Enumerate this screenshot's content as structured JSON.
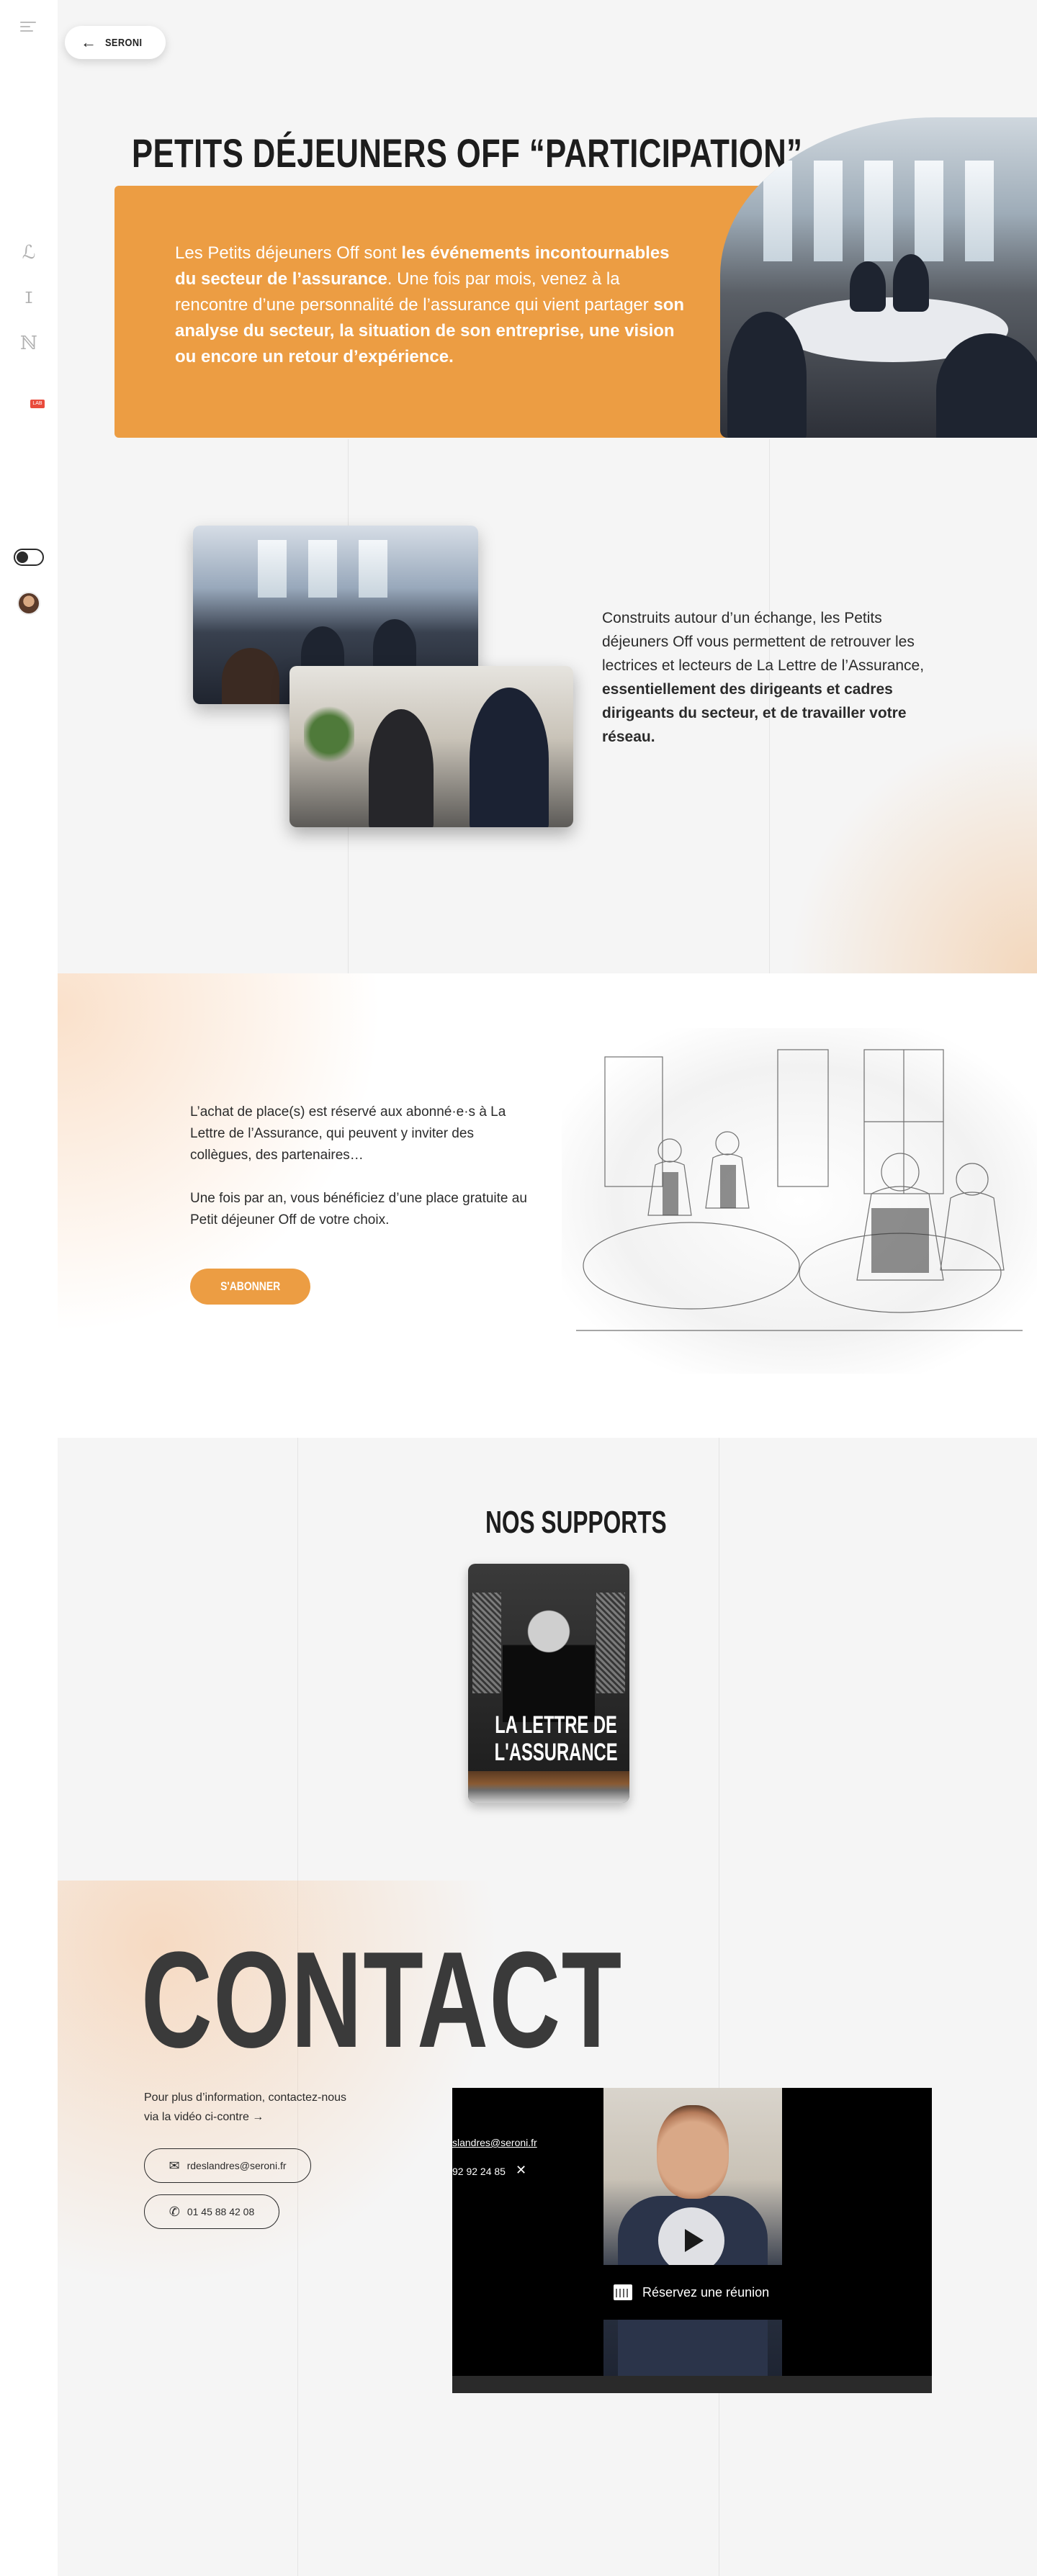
{
  "nav": {
    "back_label": "SERONI",
    "rail_lab_badge": "LAB"
  },
  "hero": {
    "title": "PETITS DÉJEUNERS OFF “PARTICIPATION”",
    "text_parts": [
      "Les Petits déjeuners Off sont ",
      "les événements incontournables du secteur de l’assurance",
      ". Une fois par mois, venez à la rencontre d’une personnalité de l’assurance qui vient partager ",
      "son analyse du secteur, la situation de son entreprise, une vision ou encore un retour d’expérience."
    ]
  },
  "intro": {
    "text_parts": [
      "Construits autour d’un échange, les Petits déjeuners Off vous permettent de retrouver les lectrices et lecteurs de La Lettre de l’Assurance, ",
      "essentiellement des dirigeants et cadres dirigeants du secteur, et de travailler votre réseau."
    ]
  },
  "subscription": {
    "paragraph1": "L’achat de place(s) est réservé aux abonné·e·s à La Lettre de l’Assurance, qui peuvent y inviter des collègues, des partenaires…",
    "paragraph2": "Une fois par an, vous bénéficiez d’une place gratuite au Petit déjeuner Off de votre choix.",
    "button_label": "S'ABONNER"
  },
  "supports": {
    "title": "NOS SUPPORTS",
    "card_label": "LA LETTRE DE L'ASSURANCE"
  },
  "contact": {
    "title": "CONTACT",
    "text": "Pour plus d’information, contactez-nous via la vidéo ci-contre →",
    "email": "rdeslandres@seroni.fr",
    "phone": "01 45 88 42 08",
    "video": {
      "email_text": "slandres@seroni.fr",
      "phone_text": "92 92 24 85",
      "close": "✕",
      "meeting_label": "Réservez une réunion"
    }
  },
  "colors": {
    "accent": "#ec9d43",
    "dark": "#1d1d1d",
    "background": "#f5f5f5"
  },
  "icons": [
    "menu-icon",
    "arrow-left-icon",
    "mail-icon",
    "phone-icon",
    "play-icon",
    "calendar-icon",
    "close-icon"
  ]
}
